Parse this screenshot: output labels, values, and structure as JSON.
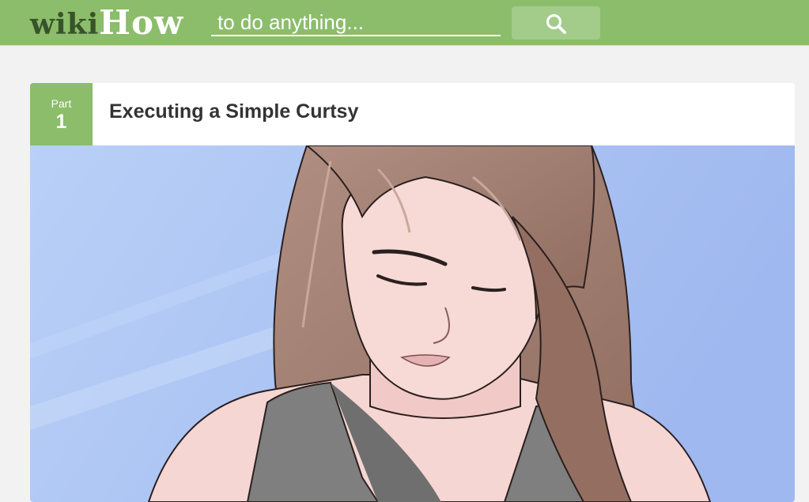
{
  "header": {
    "logo_wiki": "wiki",
    "logo_how": "How",
    "search_placeholder": "to do anything...",
    "search_icon": "search-icon"
  },
  "part": {
    "label": "Part",
    "number": "1",
    "title": "Executing a Simple Curtsy"
  },
  "colors": {
    "brand_green": "#8bbd6b",
    "logo_dark_green": "#38532a",
    "search_button": "#a3cb8a",
    "sky_blue": "#a6c0f2",
    "hair_brown": "#9f7c6d",
    "skin": "#f7d8d4",
    "shirt_gray": "#7e7e7e"
  }
}
